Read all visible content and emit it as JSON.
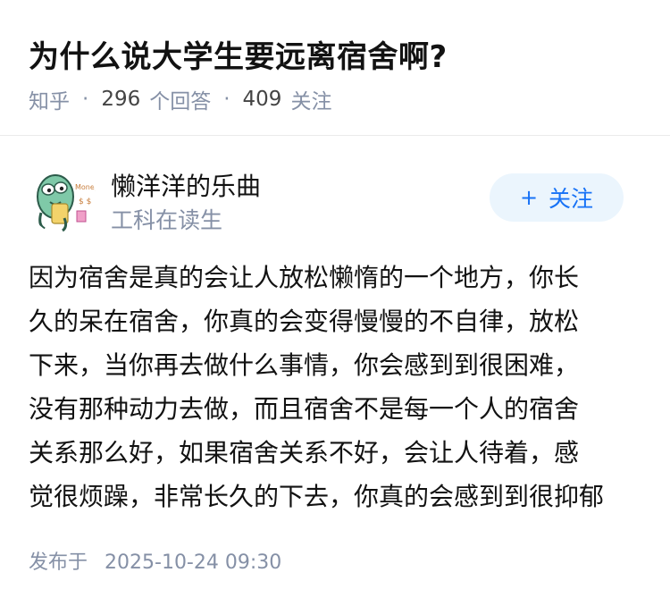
{
  "question": {
    "title": "为什么说大学生要远离宿舍啊?",
    "source": "知乎",
    "answer_count": "296",
    "answer_label": "个回答",
    "follow_count": "409",
    "follow_label": "关注"
  },
  "author": {
    "name": "懒洋洋的乐曲",
    "bio": "工科在读生",
    "follow_button_label": "关注",
    "follow_button_icon": "+"
  },
  "answer": {
    "text": "因为宿舍是真的会让人放松懒惰的一个地方，你长\n久的呆在宿舍，你真的会变得慢慢的不自律，放松\n下来，当你再去做什么事情，你会感到到很困难，\n没有那种动力去做，而且宿舍不是每一个人的宿舍\n关系那么好，如果宿舍关系不好，会让人待着，感\n觉很烦躁，非常长久的下去，你真的会感到到很抑郁"
  },
  "publish": {
    "label": "发布于",
    "datetime": "2025-10-24 09:30"
  },
  "colors": {
    "accent": "#1772f6",
    "muted": "#8590a6",
    "follow_bg": "#ebf5fd"
  }
}
